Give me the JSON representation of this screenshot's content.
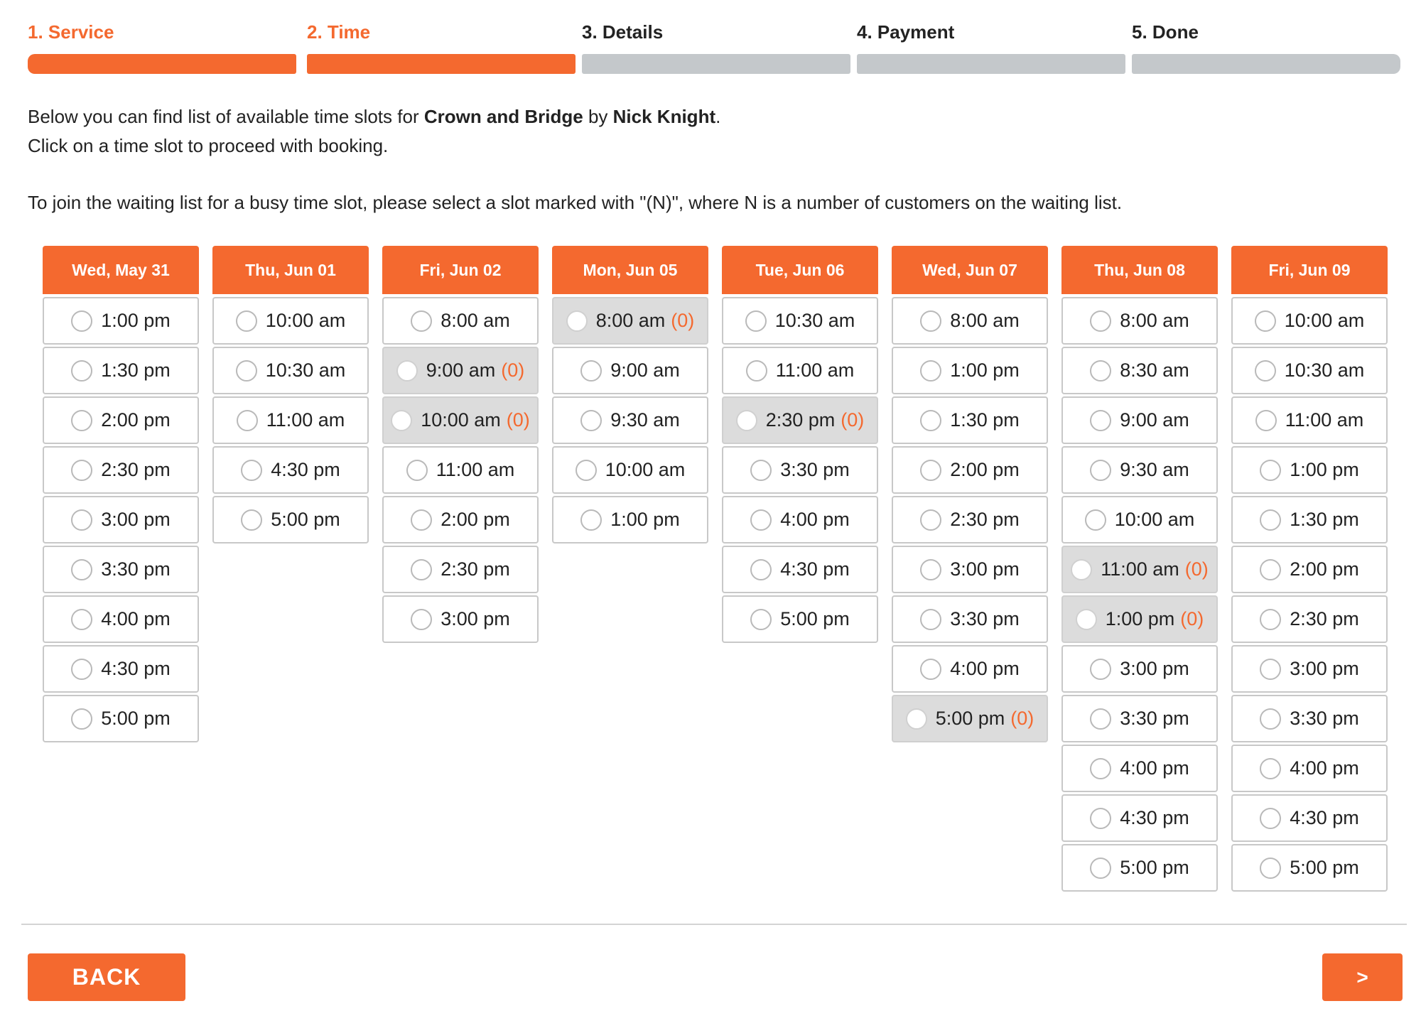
{
  "steps": [
    {
      "label": "1. Service",
      "active": true
    },
    {
      "label": "2. Time",
      "active": true
    },
    {
      "label": "3. Details",
      "active": false
    },
    {
      "label": "4. Payment",
      "active": false
    },
    {
      "label": "5. Done",
      "active": false
    }
  ],
  "info": {
    "line1_prefix": "Below you can find list of available time slots for ",
    "service": "Crown and Bridge",
    "line1_mid": " by ",
    "staff": "Nick Knight",
    "line1_suffix": ".",
    "line2": "Click on a time slot to proceed with booking.",
    "line3": "To join the waiting list for a busy time slot, please select a slot marked with \"(N)\", where N is a number of customers on the waiting list."
  },
  "days": [
    {
      "date": "Wed, May 31",
      "slots": [
        {
          "time": "1:00 pm"
        },
        {
          "time": "1:30 pm"
        },
        {
          "time": "2:00 pm"
        },
        {
          "time": "2:30 pm"
        },
        {
          "time": "3:00 pm"
        },
        {
          "time": "3:30 pm"
        },
        {
          "time": "4:00 pm"
        },
        {
          "time": "4:30 pm"
        },
        {
          "time": "5:00 pm"
        }
      ]
    },
    {
      "date": "Thu, Jun 01",
      "slots": [
        {
          "time": "10:00 am"
        },
        {
          "time": "10:30 am"
        },
        {
          "time": "11:00 am"
        },
        {
          "time": "4:30 pm"
        },
        {
          "time": "5:00 pm"
        }
      ]
    },
    {
      "date": "Fri, Jun 02",
      "slots": [
        {
          "time": "8:00 am"
        },
        {
          "time": "9:00 am",
          "wait": "(0)"
        },
        {
          "time": "10:00 am",
          "wait": "(0)"
        },
        {
          "time": "11:00 am"
        },
        {
          "time": "2:00 pm"
        },
        {
          "time": "2:30 pm"
        },
        {
          "time": "3:00 pm"
        }
      ]
    },
    {
      "date": "Mon, Jun 05",
      "slots": [
        {
          "time": "8:00 am",
          "wait": "(0)"
        },
        {
          "time": "9:00 am"
        },
        {
          "time": "9:30 am"
        },
        {
          "time": "10:00 am"
        },
        {
          "time": "1:00 pm"
        }
      ]
    },
    {
      "date": "Tue, Jun 06",
      "slots": [
        {
          "time": "10:30 am"
        },
        {
          "time": "11:00 am"
        },
        {
          "time": "2:30 pm",
          "wait": "(0)"
        },
        {
          "time": "3:30 pm"
        },
        {
          "time": "4:00 pm"
        },
        {
          "time": "4:30 pm"
        },
        {
          "time": "5:00 pm"
        }
      ]
    },
    {
      "date": "Wed, Jun 07",
      "slots": [
        {
          "time": "8:00 am"
        },
        {
          "time": "1:00 pm"
        },
        {
          "time": "1:30 pm"
        },
        {
          "time": "2:00 pm"
        },
        {
          "time": "2:30 pm"
        },
        {
          "time": "3:00 pm"
        },
        {
          "time": "3:30 pm"
        },
        {
          "time": "4:00 pm"
        },
        {
          "time": "5:00 pm",
          "wait": "(0)"
        }
      ]
    },
    {
      "date": "Thu, Jun 08",
      "slots": [
        {
          "time": "8:00 am"
        },
        {
          "time": "8:30 am"
        },
        {
          "time": "9:00 am"
        },
        {
          "time": "9:30 am"
        },
        {
          "time": "10:00 am"
        },
        {
          "time": "11:00 am",
          "wait": "(0)"
        },
        {
          "time": "1:00 pm",
          "wait": "(0)"
        },
        {
          "time": "3:00 pm"
        },
        {
          "time": "3:30 pm"
        },
        {
          "time": "4:00 pm"
        },
        {
          "time": "4:30 pm"
        },
        {
          "time": "5:00 pm"
        }
      ]
    },
    {
      "date": "Fri, Jun 09",
      "slots": [
        {
          "time": "10:00 am"
        },
        {
          "time": "10:30 am"
        },
        {
          "time": "11:00 am"
        },
        {
          "time": "1:00 pm"
        },
        {
          "time": "1:30 pm"
        },
        {
          "time": "2:00 pm"
        },
        {
          "time": "2:30 pm"
        },
        {
          "time": "3:00 pm"
        },
        {
          "time": "3:30 pm"
        },
        {
          "time": "4:00 pm"
        },
        {
          "time": "4:30 pm"
        },
        {
          "time": "5:00 pm"
        }
      ]
    }
  ],
  "buttons": {
    "back": "BACK",
    "next": ">"
  },
  "colors": {
    "accent": "#f4692f",
    "inactive_bar": "#c4c8cb",
    "busy_slot": "#dcdcdc"
  }
}
